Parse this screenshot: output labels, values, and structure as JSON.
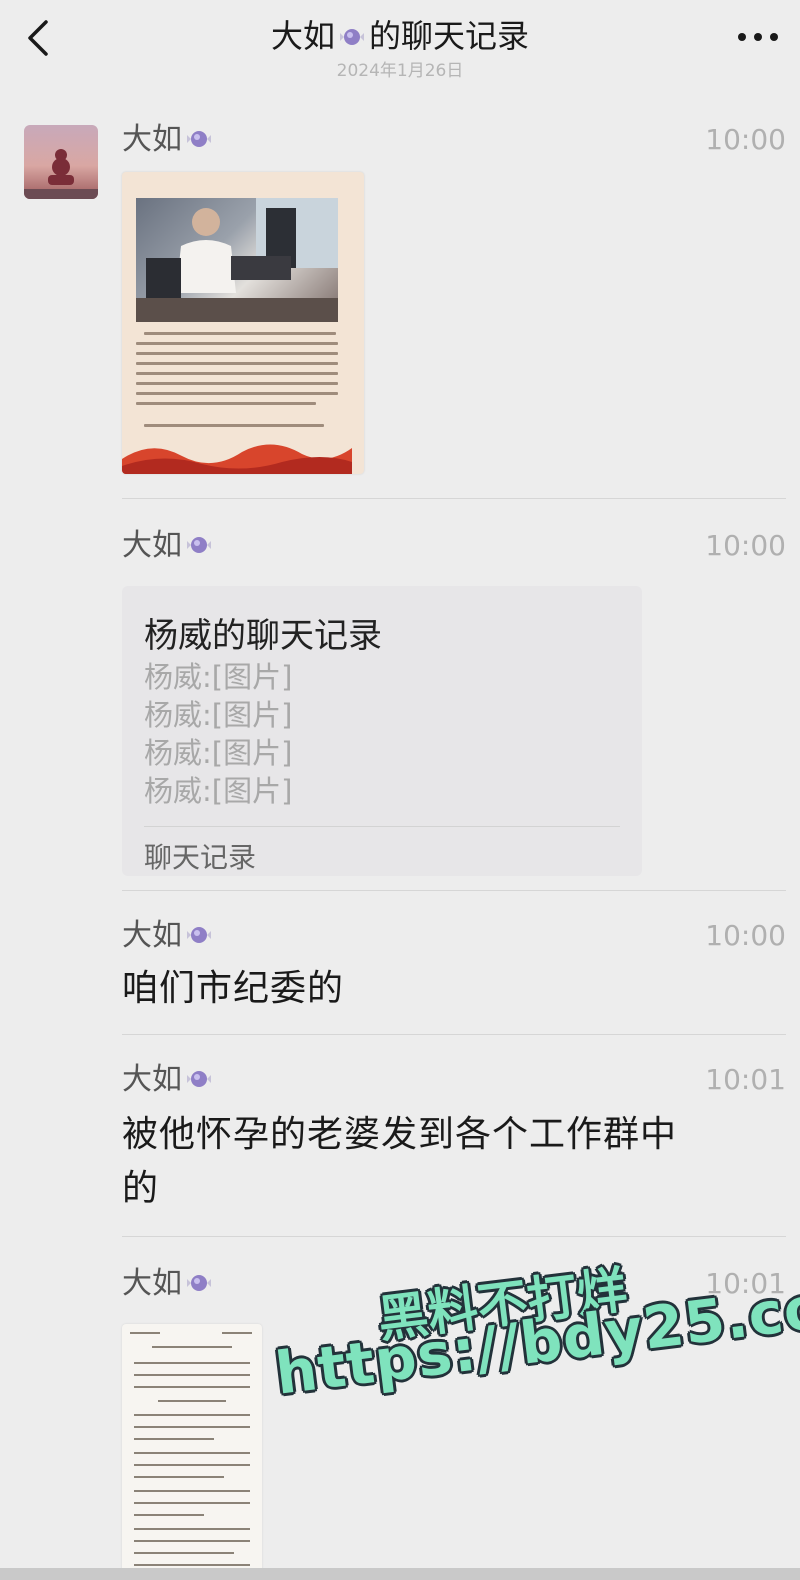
{
  "header": {
    "title_prefix": "大如",
    "title_suffix": "的聊天记录",
    "date": "2024年1月26日"
  },
  "messages": [
    {
      "sender": "大如",
      "time": "10:00",
      "kind": "image"
    },
    {
      "sender": "大如",
      "time": "10:00",
      "kind": "chat_record",
      "card": {
        "title": "杨威的聊天记录",
        "lines": [
          "杨威:[图片]",
          "杨威:[图片]",
          "杨威:[图片]",
          "杨威:[图片]"
        ],
        "footer": "聊天记录"
      }
    },
    {
      "sender": "大如",
      "time": "10:00",
      "kind": "text",
      "text": "咱们市纪委的"
    },
    {
      "sender": "大如",
      "time": "10:01",
      "kind": "text",
      "text_line1": "被他怀孕的老婆发到各个工作群中",
      "text_line2": "的"
    },
    {
      "sender": "大如",
      "time": "10:01",
      "kind": "image"
    }
  ],
  "watermark": {
    "line1": "黑料不打烊",
    "line2": "https://bdy25.co"
  },
  "icons": {
    "back": "chevron-left-icon",
    "more": "more-dots-icon",
    "candy": "candy-emoji-icon"
  }
}
